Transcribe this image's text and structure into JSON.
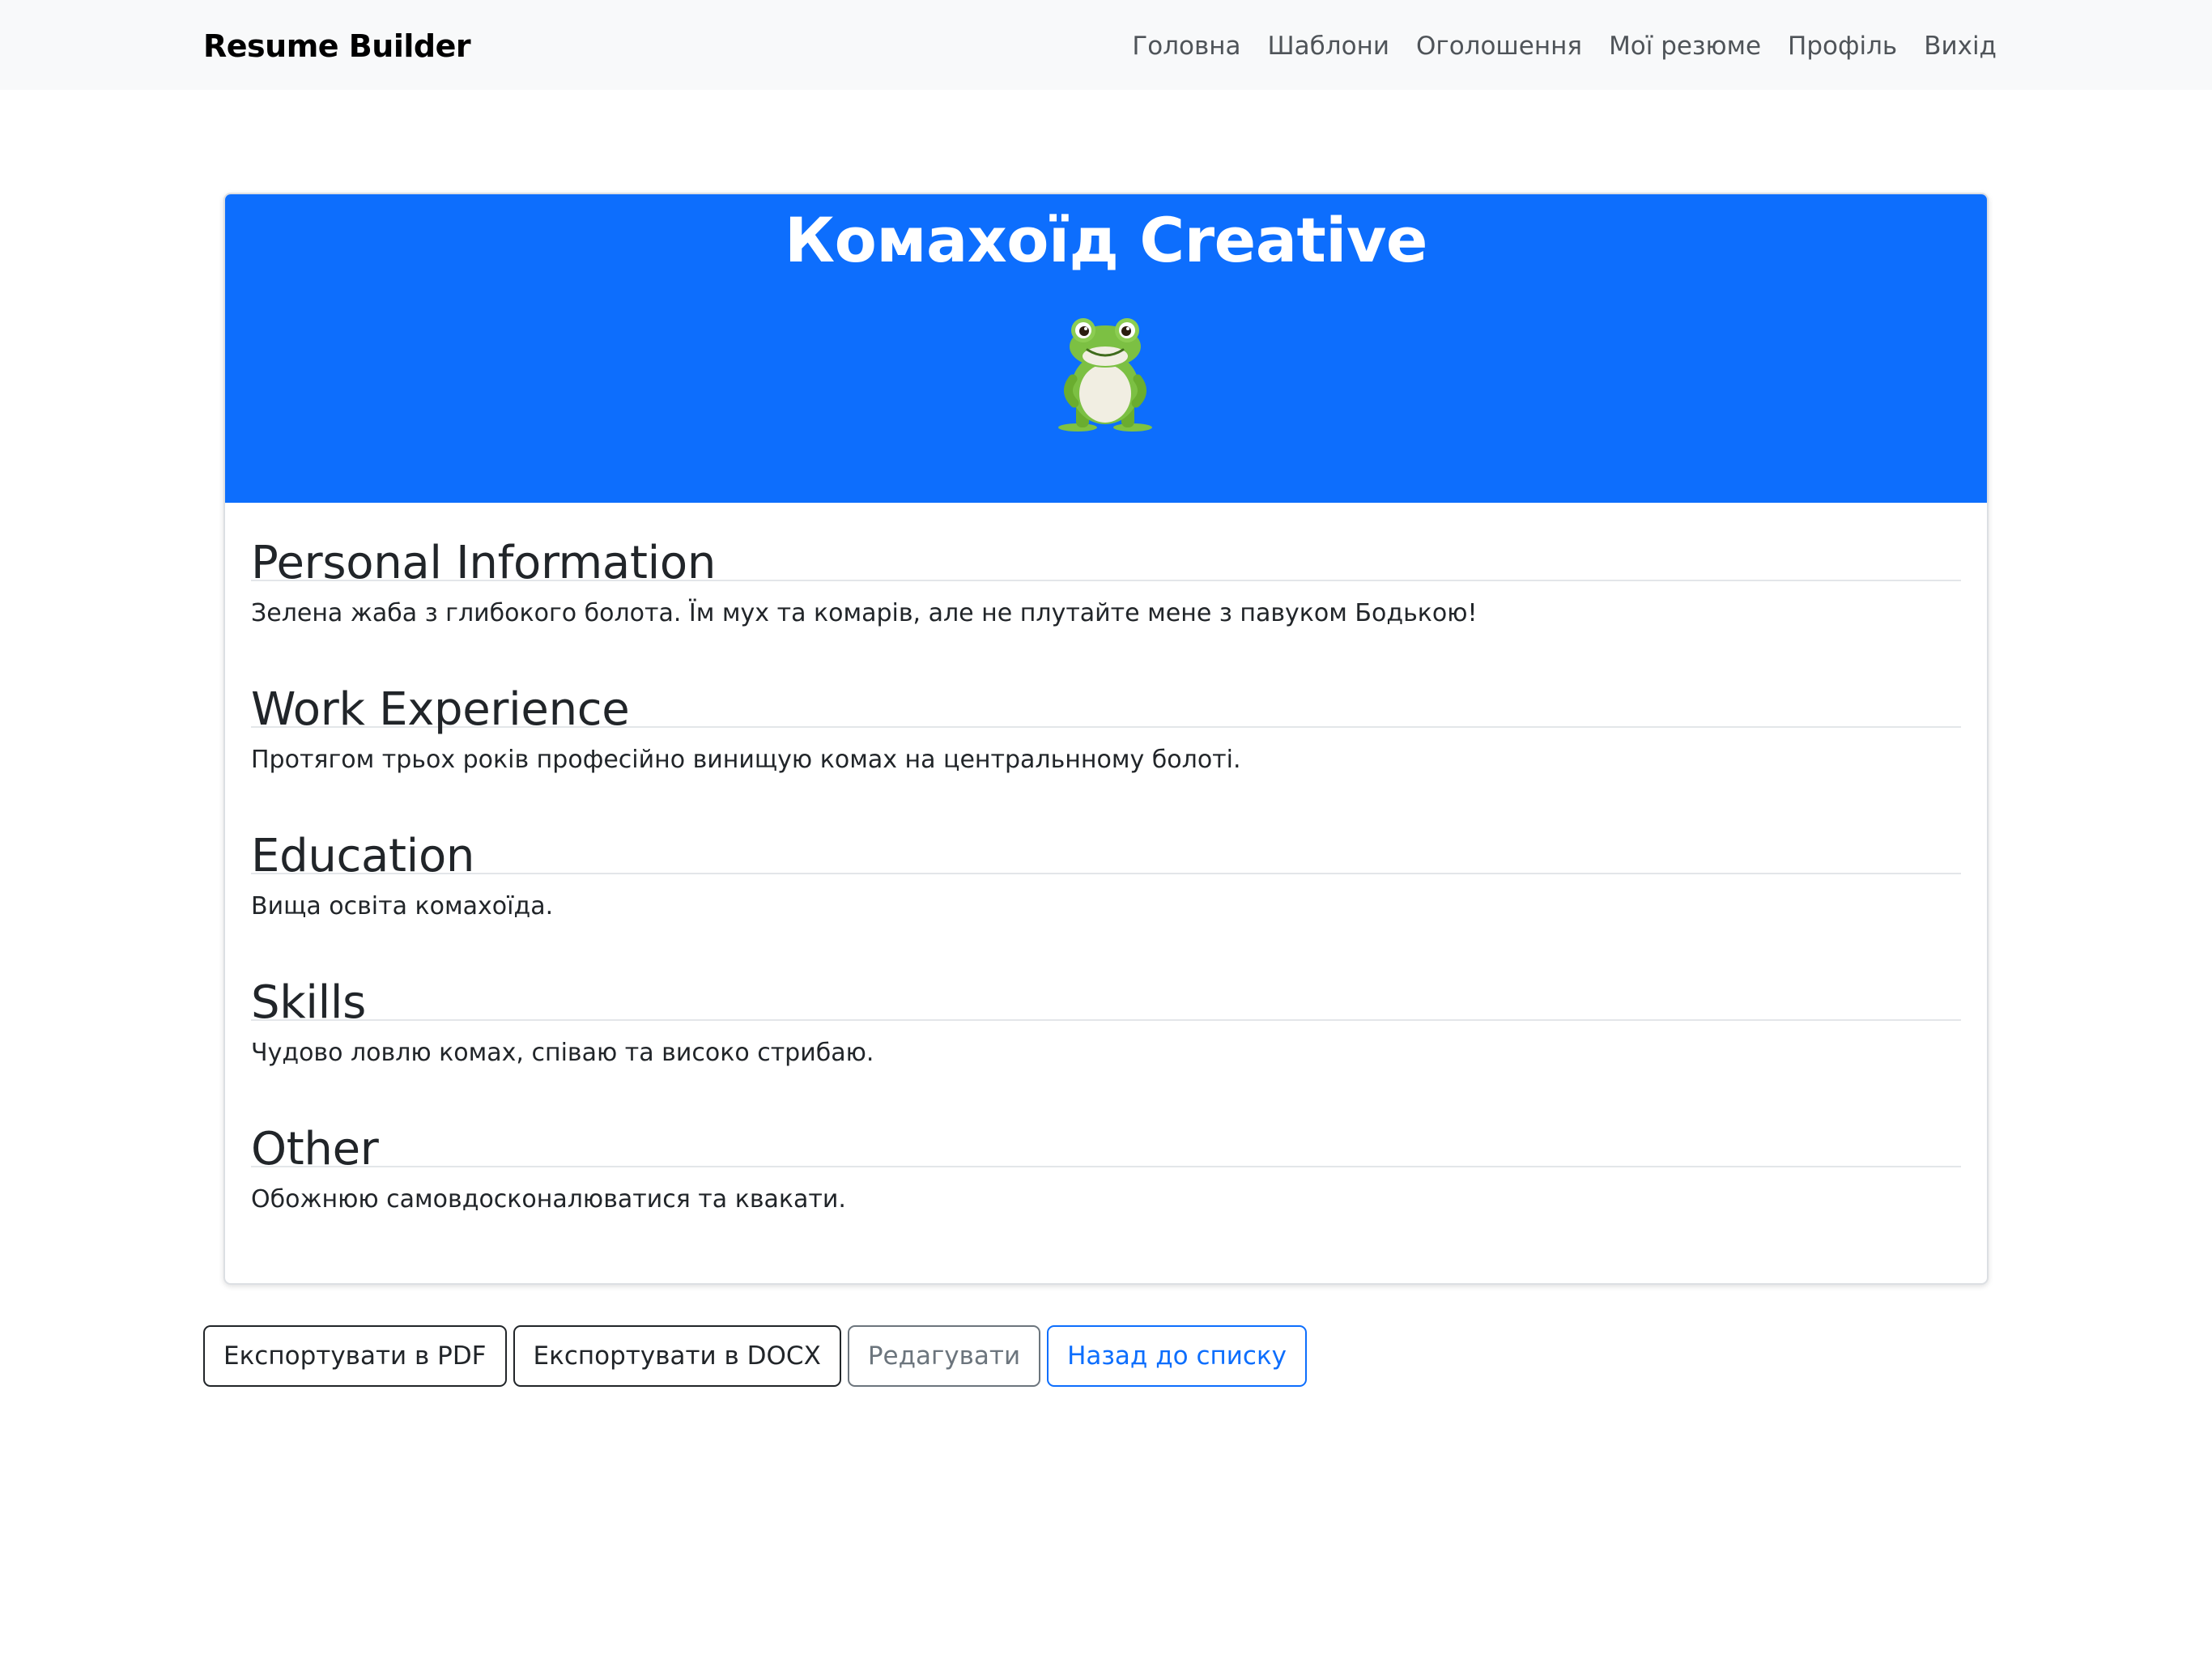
{
  "navbar": {
    "brand": "Resume Builder",
    "links": [
      "Головна",
      "Шаблони",
      "Оголошення",
      "Мої резюме",
      "Профіль",
      "Вихід"
    ]
  },
  "resume": {
    "title": "Комахоїд Creative",
    "avatar": "frog-avatar",
    "sections": [
      {
        "heading": "Personal Information",
        "text": "Зелена жаба з глибокого болота. Їм мух та комарів, але не плутайте мене з павуком Бодькою!"
      },
      {
        "heading": "Work Experience",
        "text": "Протягом трьох років професійно винищую комах на центральнному болоті."
      },
      {
        "heading": "Education",
        "text": "Вища освіта комахоїда."
      },
      {
        "heading": "Skills",
        "text": "Чудово ловлю комах, співаю та високо стрибаю."
      },
      {
        "heading": "Other",
        "text": "Обожнюю самовдосконалюватися та квакати."
      }
    ]
  },
  "actions": {
    "export_pdf": "Експортувати в PDF",
    "export_docx": "Експортувати в DOCX",
    "edit": "Редагувати",
    "back": "Назад до списку"
  },
  "colors": {
    "primary": "#0d6efd",
    "navbar_bg": "#f8f9fa",
    "text": "#212529",
    "secondary": "#6c757d"
  }
}
